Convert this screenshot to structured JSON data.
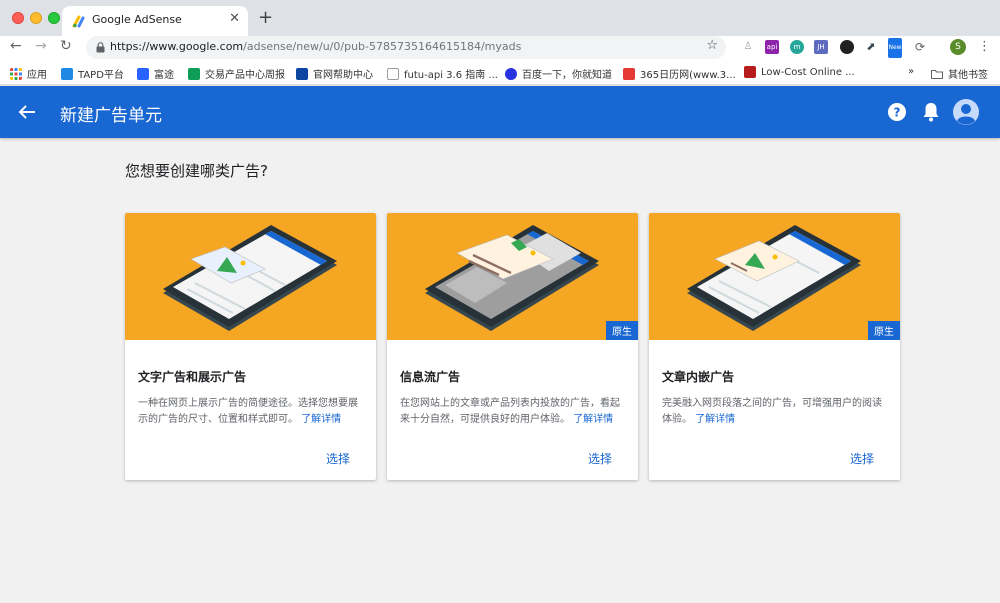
{
  "browser": {
    "tab_title": "Google AdSense",
    "url_host": "https://www.google.com",
    "url_path": "/adsense/new/u/0/pub-5785735164615184/myads",
    "profile_initial": "S",
    "extensions": [
      {
        "icon": "puzzle-icon",
        "text": "",
        "color": "#9aa0a6"
      },
      {
        "icon": "ext-purple-icon",
        "text": "api",
        "color": "#8e24aa"
      },
      {
        "icon": "ext-teal-icon",
        "text": "m",
        "color": "#26a69a"
      },
      {
        "icon": "ext-jh-icon",
        "text": "JH",
        "color": "#5c6bc0"
      },
      {
        "icon": "ext-dark-icon",
        "text": "",
        "color": "#212121"
      },
      {
        "icon": "ext-chart-icon",
        "text": "",
        "color": "#37474f"
      },
      {
        "icon": "ext-new-icon",
        "text": "New",
        "color": "#1a73e8"
      },
      {
        "icon": "ext-sync-icon",
        "text": "",
        "color": "#5f6368"
      }
    ],
    "bookmarks": [
      {
        "label": "应用",
        "icon": "apps-grid-icon",
        "color": "#ea4335"
      },
      {
        "label": "TAPD平台",
        "icon": "tapd-icon",
        "color": "#1e88e5"
      },
      {
        "label": "富途",
        "icon": "futu-icon",
        "color": "#2962ff"
      },
      {
        "label": "交易产品中心周报",
        "icon": "sheets-icon",
        "color": "#0f9d58"
      },
      {
        "label": "官网帮助中心",
        "icon": "help-center-icon",
        "color": "#0d47a1"
      },
      {
        "label": "futu-api 3.6 指南 ...",
        "icon": "doc-icon",
        "color": "#9e9e9e"
      },
      {
        "label": "百度一下，你就知道",
        "icon": "baidu-icon",
        "color": "#2932e1"
      },
      {
        "label": "365日历网(www.3...",
        "icon": "calendar-365-icon",
        "color": "#e53935"
      },
      {
        "label": "Low-Cost Online ...",
        "icon": "lowcost-icon",
        "color": "#b71c1c"
      }
    ],
    "bookmarks_overflow": "»",
    "other_bookmarks": "其他书签"
  },
  "appbar": {
    "title": "新建广告单元",
    "color": "#1967d2"
  },
  "main": {
    "heading": "您想要创建哪类广告?",
    "cards": [
      {
        "title": "文字广告和展示广告",
        "desc": "一种在网页上展示广告的简便途径。选择您想要展示的广告的尺寸、位置和样式即可。",
        "link": "了解详情",
        "select": "选择",
        "badge": ""
      },
      {
        "title": "信息流广告",
        "desc": "在您网站上的文章或产品列表内投放的广告，看起来十分自然，可提供良好的用户体验。",
        "link": "了解详情",
        "select": "选择",
        "badge": "原生"
      },
      {
        "title": "文章内嵌广告",
        "desc": "完美融入网页段落之间的广告，可增强用户的阅读体验。",
        "link": "了解详情",
        "select": "选择",
        "badge": "原生"
      }
    ],
    "hero_color": "#f5a623"
  }
}
